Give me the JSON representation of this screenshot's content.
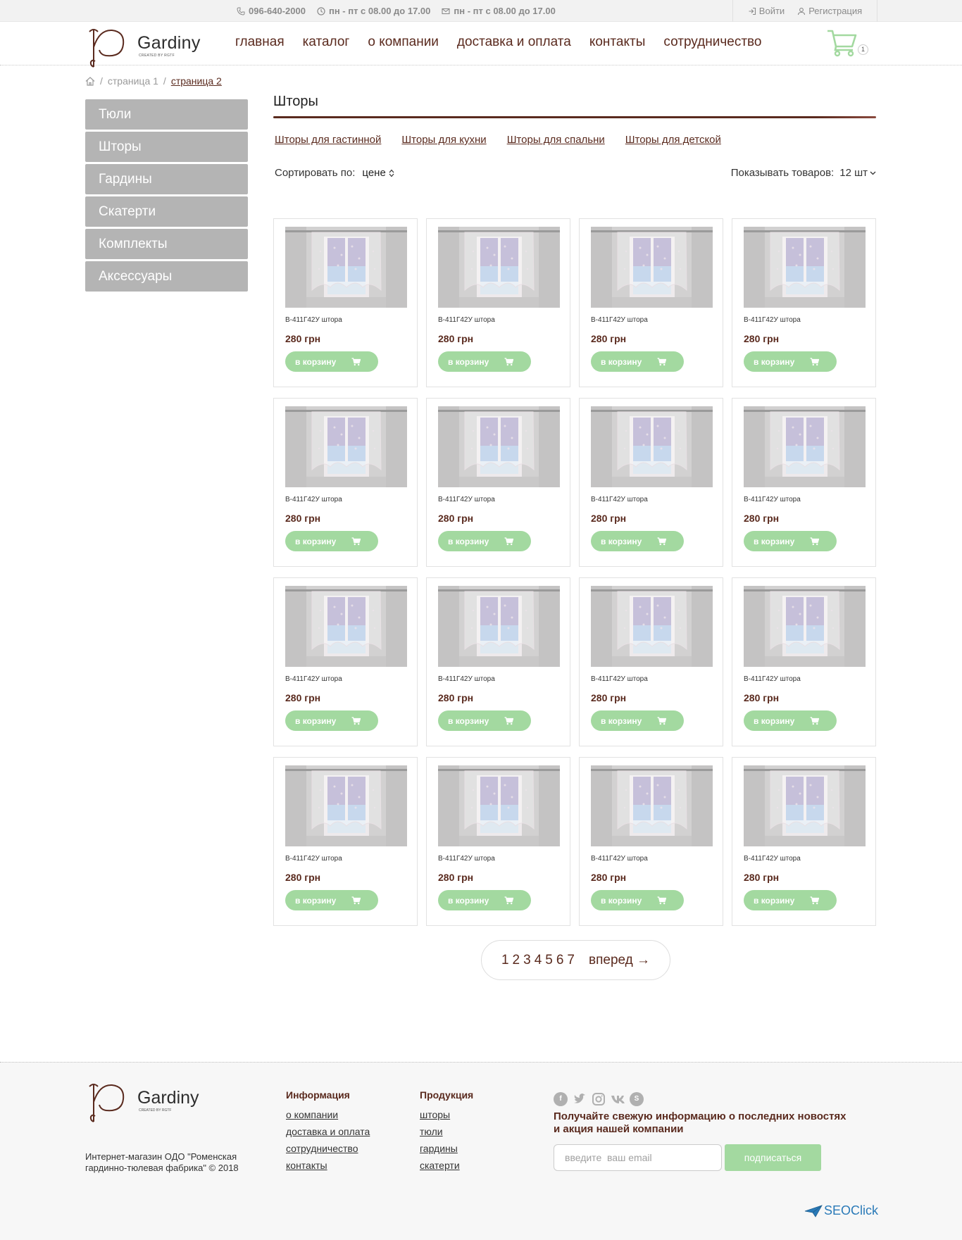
{
  "topbar": {
    "phone": "096-640-2000",
    "hours": "пн - пт с 08.00 до 17.00",
    "email_hours": "пн - пт с 08.00 до 17.00",
    "login": "Войти",
    "register": "Регистрация"
  },
  "header": {
    "brand": "Gardiny",
    "tagline": "CREATED BY RGTF",
    "nav": [
      "главная",
      "каталог",
      "о компании",
      "доставка и оплата",
      "контакты",
      "сотрудничество"
    ],
    "cart_count": "1"
  },
  "breadcrumb": [
    "страница 1",
    "страница 2"
  ],
  "sidebar": [
    "Тюли",
    "Шторы",
    "Гардины",
    "Скатерти",
    "Комплекты",
    "Аксессуары"
  ],
  "main": {
    "title": "Шторы",
    "subcategories": [
      "Шторы для гастинной",
      "Шторы для кухни",
      "Шторы для спальни",
      "Шторы для детской"
    ],
    "sort_label": "Сортировать по:",
    "sort_value": "цене",
    "show_label": "Показывать товаров:",
    "show_value": "12 шт"
  },
  "products": [
    {
      "name": "В-411Г42У штора",
      "price": "280 грн",
      "button": "в корзину"
    },
    {
      "name": "В-411Г42У штора",
      "price": "280 грн",
      "button": "в корзину"
    },
    {
      "name": "В-411Г42У штора",
      "price": "280 грн",
      "button": "в корзину"
    },
    {
      "name": "В-411Г42У штора",
      "price": "280 грн",
      "button": "в корзину"
    },
    {
      "name": "В-411Г42У штора",
      "price": "280 грн",
      "button": "в корзину"
    },
    {
      "name": "В-411Г42У штора",
      "price": "280 грн",
      "button": "в корзину"
    },
    {
      "name": "В-411Г42У штора",
      "price": "280 грн",
      "button": "в корзину"
    },
    {
      "name": "В-411Г42У штора",
      "price": "280 грн",
      "button": "в корзину"
    },
    {
      "name": "В-411Г42У штора",
      "price": "280 грн",
      "button": "в корзину"
    },
    {
      "name": "В-411Г42У штора",
      "price": "280 грн",
      "button": "в корзину"
    },
    {
      "name": "В-411Г42У штора",
      "price": "280 грн",
      "button": "в корзину"
    },
    {
      "name": "В-411Г42У штора",
      "price": "280 грн",
      "button": "в корзину"
    },
    {
      "name": "В-411Г42У штора",
      "price": "280 грн",
      "button": "в корзину"
    },
    {
      "name": "В-411Г42У штора",
      "price": "280 грн",
      "button": "в корзину"
    },
    {
      "name": "В-411Г42У штора",
      "price": "280 грн",
      "button": "в корзину"
    },
    {
      "name": "В-411Г42У штора",
      "price": "280 грн",
      "button": "в корзину"
    }
  ],
  "pagination": {
    "pages": [
      "1",
      "2",
      "3",
      "4",
      "5",
      "6",
      "7"
    ],
    "next": "вперед →"
  },
  "footer": {
    "brand": "Gardiny",
    "tagline": "CREATED BY RGTF",
    "copyright": "Интернет-магазин ОДО \"Роменская гардинно-тюлевая фабрика\" © 2018",
    "info_title": "Информация",
    "info_links": [
      "о компании",
      "доставка и оплата",
      "сотрудничество",
      "контакты"
    ],
    "products_title": "Продукция",
    "products_links": [
      "шторы",
      "тюли",
      "гардины",
      "скатерти"
    ],
    "newsletter_text": "Получайте свежую информацию о последних новостях и акция нашей компании",
    "email_placeholder": "введите  ваш email",
    "subscribe": "подписаться",
    "credit": "SEOClick"
  },
  "icons": {
    "phone": "phone-icon",
    "clock": "clock-icon",
    "mail": "mail-icon",
    "login": "login-icon",
    "user": "user-icon",
    "cart": "cart-icon",
    "home": "home-icon"
  },
  "colors": {
    "accent": "#5a2a1e",
    "green": "#a3d9a0",
    "sidebar": "#b4b4b4"
  }
}
